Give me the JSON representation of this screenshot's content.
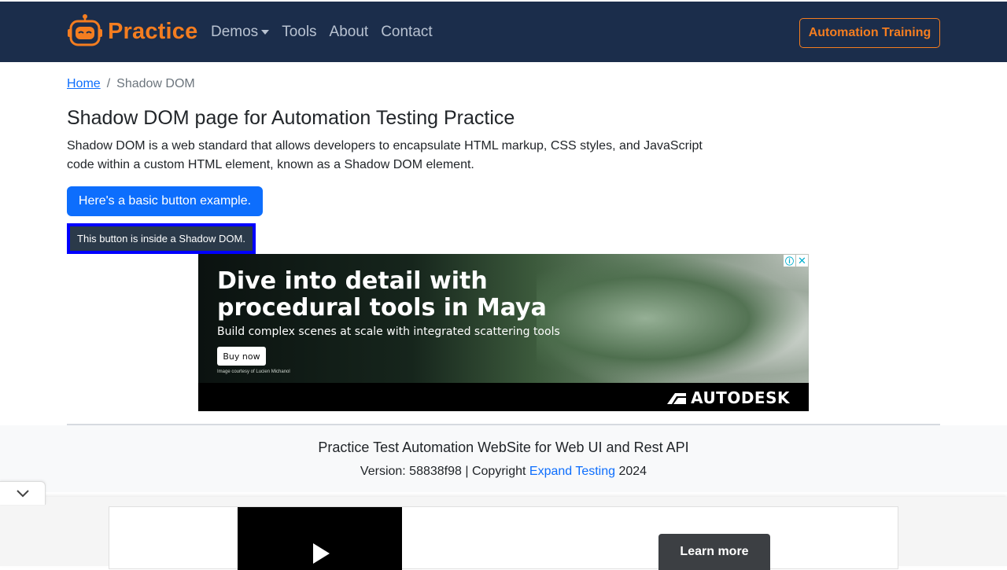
{
  "navbar": {
    "brand": "Practice",
    "links": [
      {
        "label": "Demos",
        "has_dropdown": true
      },
      {
        "label": "Tools",
        "has_dropdown": false
      },
      {
        "label": "About",
        "has_dropdown": false
      },
      {
        "label": "Contact",
        "has_dropdown": false
      }
    ],
    "cta": "Automation Training",
    "colors": {
      "background": "#1b2d4b",
      "accent": "#f47d20"
    }
  },
  "breadcrumb": {
    "home": "Home",
    "separator": "/",
    "current": "Shadow DOM"
  },
  "main": {
    "title": "Shadow DOM page for Automation Testing Practice",
    "description": "Shadow DOM is a web standard that allows developers to encapsulate HTML markup, CSS styles, and JavaScript code within a custom HTML element, known as a Shadow DOM element.",
    "basic_button": "Here's a basic button example.",
    "shadow_button": "This button is inside a Shadow DOM."
  },
  "ad": {
    "headline": "Dive into detail with procedural tools in Maya",
    "subtext": "Build complex scenes at scale with integrated scattering tools",
    "cta": "Buy now",
    "credit": "Image courtesy of Lucien Michanol",
    "brand": "AUTODESK",
    "info_icon": "info-icon",
    "close_icon": "close-icon"
  },
  "footer": {
    "title": "Practice Test Automation WebSite for Web UI and Rest API",
    "version_prefix": "Version: 58838f98 | Copyright ",
    "company": "Expand Testing",
    "year": " 2024"
  },
  "anchor_ad": {
    "collapse_icon": "chevron-down-icon",
    "play_icon": "play-icon",
    "cta": "Learn more"
  }
}
